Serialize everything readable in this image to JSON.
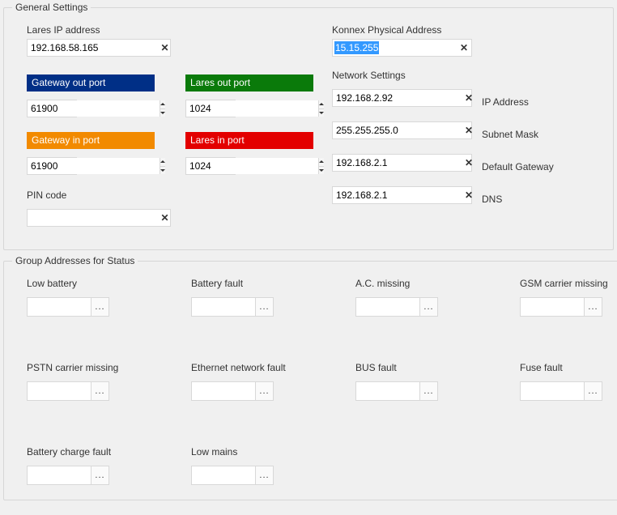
{
  "general": {
    "title": "General Settings",
    "lares_ip": {
      "label": "Lares IP address",
      "value": "192.168.58.165"
    },
    "gateway_out": {
      "label": "Gateway out port",
      "value": "61900"
    },
    "lares_out": {
      "label": "Lares out port",
      "value": "1024"
    },
    "gateway_in": {
      "label": "Gateway in port",
      "value": "61900"
    },
    "lares_in": {
      "label": "Lares in port",
      "value": "1024"
    },
    "pin": {
      "label": "PIN code",
      "value": ""
    },
    "konnex": {
      "label": "Konnex Physical Address",
      "value": "15.15.255"
    },
    "network": {
      "title": "Network Settings",
      "ip": {
        "label": "IP Address",
        "value": "192.168.2.92"
      },
      "mask": {
        "label": "Subnet Mask",
        "value": "255.255.255.0"
      },
      "gateway": {
        "label": "Default Gateway",
        "value": "192.168.2.1"
      },
      "dns": {
        "label": "DNS",
        "value": "192.168.2.1"
      }
    }
  },
  "status": {
    "title": "Group Addresses for Status",
    "items": [
      {
        "label": "Low battery",
        "value": ""
      },
      {
        "label": "Battery fault",
        "value": ""
      },
      {
        "label": "A.C. missing",
        "value": ""
      },
      {
        "label": "GSM carrier missing",
        "value": ""
      },
      {
        "label": "PSTN carrier missing",
        "value": ""
      },
      {
        "label": "Ethernet network fault",
        "value": ""
      },
      {
        "label": "BUS fault",
        "value": ""
      },
      {
        "label": "Fuse fault",
        "value": ""
      },
      {
        "label": "Battery charge fault",
        "value": ""
      },
      {
        "label": "Low mains",
        "value": ""
      }
    ]
  },
  "glyphs": {
    "clear": "✕",
    "dots": "..."
  }
}
